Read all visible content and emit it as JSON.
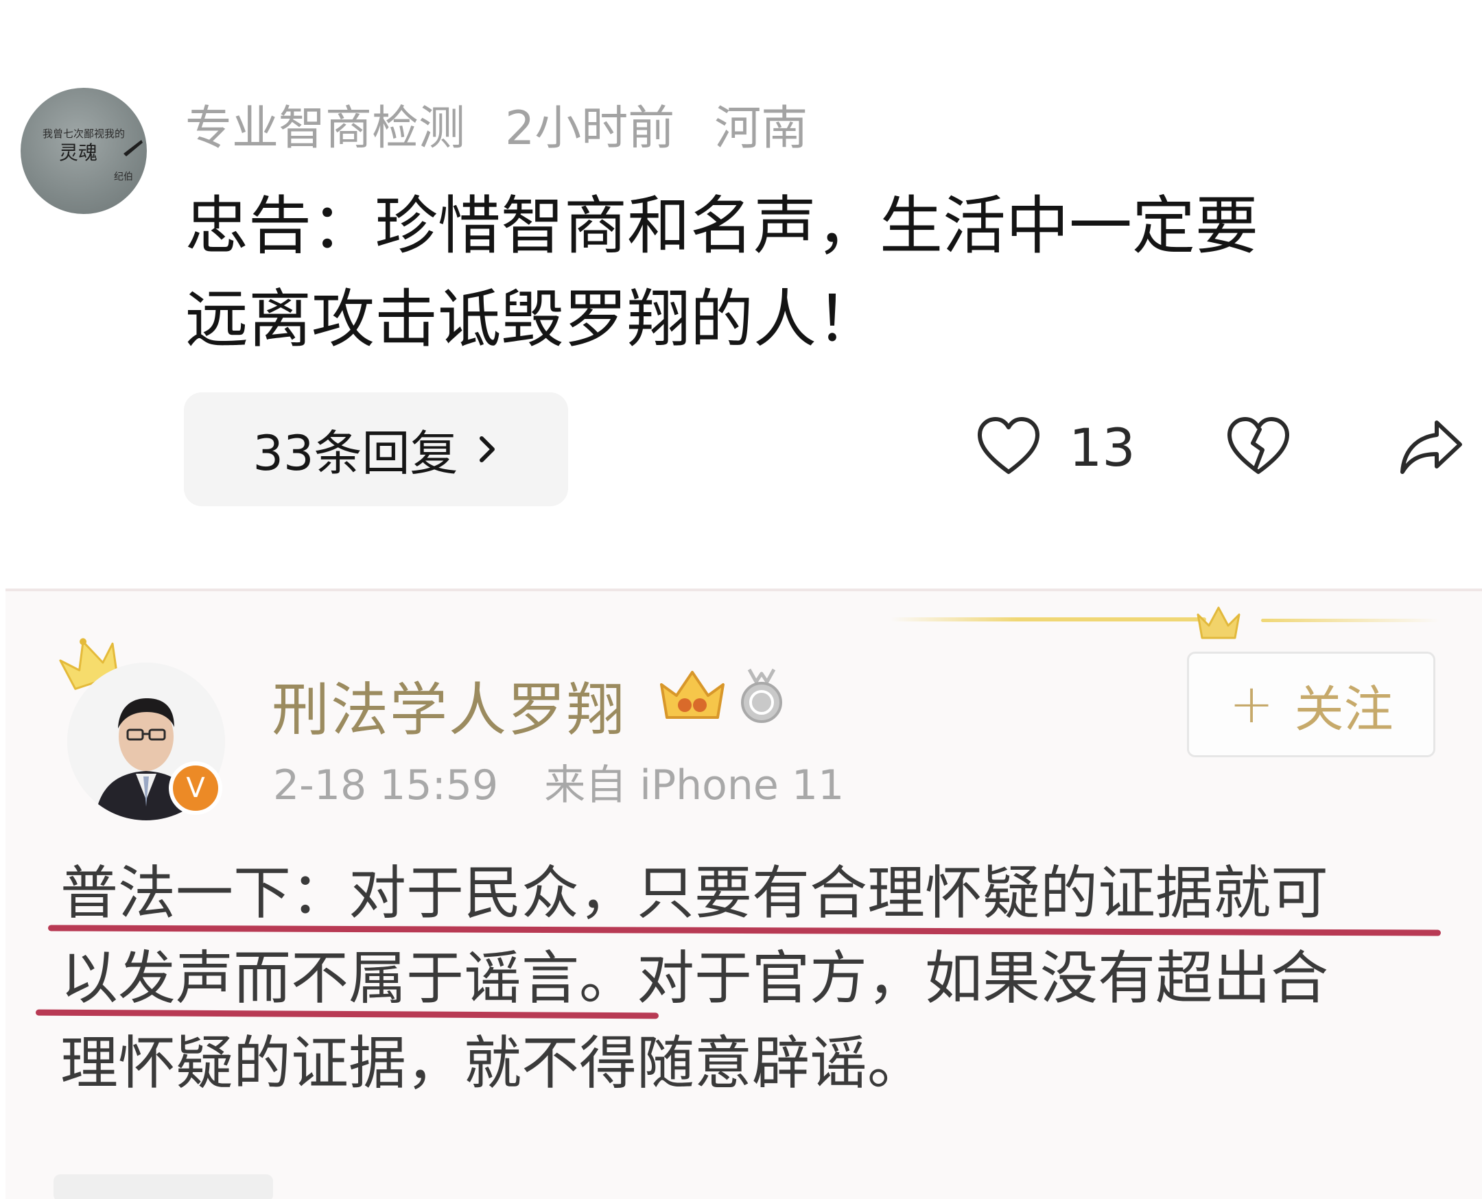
{
  "comment": {
    "avatar_text": [
      "我曾七次鄙视我的",
      "灵魂",
      "纪伯"
    ],
    "username": "专业智商检测",
    "time": "2小时前",
    "location": "河南",
    "text_lines": [
      "忠告：珍惜智商和名声，生活中一定要",
      "远离攻击诋毁罗翔的人！"
    ],
    "replies_label": "33条回复",
    "like_icon": "heart-outline-icon",
    "like_count": "13",
    "dislike_icon": "broken-heart-icon",
    "share_icon": "share-arrow-icon"
  },
  "embedded_post": {
    "author_name": "刑法学人罗翔",
    "verified_badge": "V",
    "time": "2-18 15:59",
    "source": "来自 iPhone 11",
    "follow_plus": "+",
    "follow_label": "关注",
    "text_lines": [
      "普法一下：对于民众，只要有合理怀疑的证据就可",
      "以发声而不属于谣言。对于官方，如果没有超出合",
      "理怀疑的证据，就不得随意辟谣。"
    ],
    "underline_color": "#b83a54",
    "accent_gold": "#f0d775",
    "name_color": "#9b8b5f"
  }
}
